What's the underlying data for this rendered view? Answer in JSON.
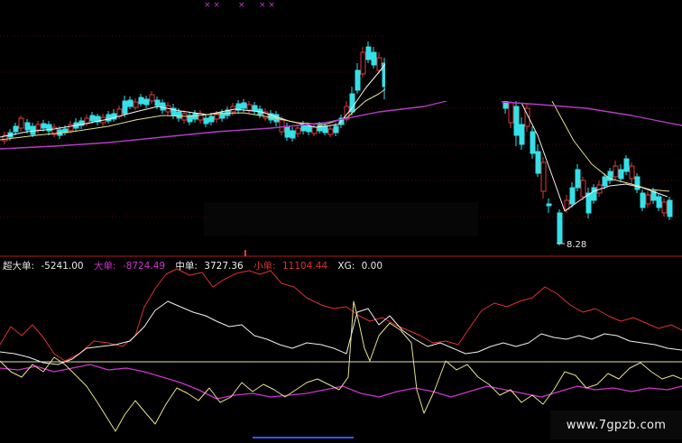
{
  "colors": {
    "background": "#000000",
    "grid": "#5a0000",
    "divider": "#b01818",
    "up": "#e03a3a",
    "down": "#35e0e8",
    "ma_fast": "#f4f4f4",
    "ma_mid": "#e8e08a",
    "ma_slow": "#b43cc8",
    "super_big": "#e8e8e8",
    "big": "#cc33cc",
    "mid": "#f0f0f0",
    "small": "#e03030",
    "xg": "#e8e8e8"
  },
  "header": {
    "markers": [
      "× ×",
      "×",
      "× ×"
    ]
  },
  "price_pane": {
    "low_label": "8.28"
  },
  "indicator": {
    "items": [
      {
        "key": "super_big",
        "label": "超大单: ",
        "value": "-5241.00"
      },
      {
        "key": "big",
        "label": "大单: ",
        "value": "-8724.49"
      },
      {
        "key": "mid",
        "label": "中单: ",
        "value": "3727.36"
      },
      {
        "key": "small",
        "label": "小单: ",
        "value": "11104.44"
      },
      {
        "key": "xg",
        "label": "XG: ",
        "value": "0.00"
      }
    ]
  },
  "watermark": {
    "text": "www.7gpzb.com"
  }
}
